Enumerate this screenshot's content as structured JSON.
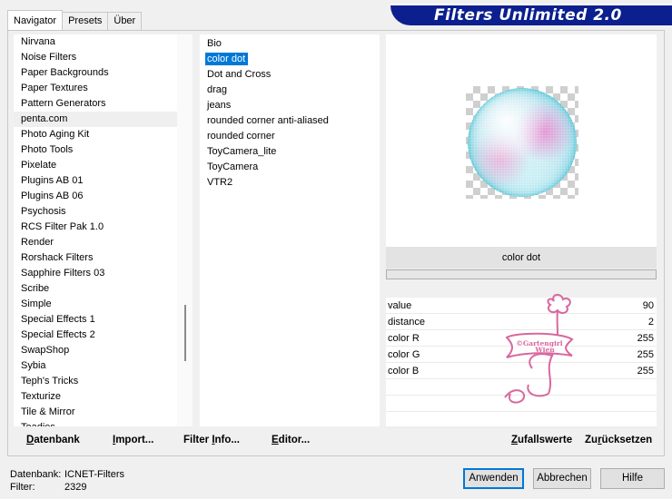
{
  "tabs": [
    {
      "label": "Navigator",
      "active": true
    },
    {
      "label": "Presets",
      "active": false
    },
    {
      "label": "Über",
      "active": false
    }
  ],
  "banner": {
    "title": "Filters Unlimited 2.0",
    "color": "#0b1f8e"
  },
  "categories": [
    {
      "label": "Nirvana"
    },
    {
      "label": "Noise Filters"
    },
    {
      "label": "Paper Backgrounds"
    },
    {
      "label": "Paper Textures"
    },
    {
      "label": "Pattern Generators"
    },
    {
      "label": "penta.com",
      "highlighted": true
    },
    {
      "label": "Photo Aging Kit"
    },
    {
      "label": "Photo Tools"
    },
    {
      "label": "Pixelate"
    },
    {
      "label": "Plugins AB 01"
    },
    {
      "label": "Plugins AB 06"
    },
    {
      "label": "Psychosis"
    },
    {
      "label": "RCS Filter Pak 1.0"
    },
    {
      "label": "Render"
    },
    {
      "label": "Rorshack Filters"
    },
    {
      "label": "Sapphire Filters 03"
    },
    {
      "label": "Scribe"
    },
    {
      "label": "Simple"
    },
    {
      "label": "Special Effects 1"
    },
    {
      "label": "Special Effects 2"
    },
    {
      "label": "SwapShop"
    },
    {
      "label": "Sybia"
    },
    {
      "label": "Teph's Tricks"
    },
    {
      "label": "Texturize"
    },
    {
      "label": "Tile & Mirror"
    },
    {
      "label": "Toadies"
    }
  ],
  "filters": [
    {
      "label": "Bio"
    },
    {
      "label": "color dot",
      "selected": true
    },
    {
      "label": "Dot and Cross"
    },
    {
      "label": "drag"
    },
    {
      "label": "jeans"
    },
    {
      "label": "rounded corner anti-aliased"
    },
    {
      "label": "rounded corner"
    },
    {
      "label": "ToyCamera_lite"
    },
    {
      "label": "ToyCamera"
    },
    {
      "label": "VTR2"
    }
  ],
  "preview": {
    "filter_name": "color dot"
  },
  "params": [
    {
      "label": "value",
      "value": "90"
    },
    {
      "label": "distance",
      "value": "2"
    },
    {
      "label": "color R",
      "value": "255"
    },
    {
      "label": "color G",
      "value": "255"
    },
    {
      "label": "color B",
      "value": "255"
    }
  ],
  "watermark": {
    "line1": "©Gartengirl",
    "line2": "Wien",
    "color": "#d9679e"
  },
  "toolbar_left": {
    "datenbank": {
      "pre": "",
      "u": "D",
      "post": "atenbank"
    },
    "import": {
      "pre": "",
      "u": "I",
      "post": "mport..."
    },
    "filterinfo": {
      "pre": "Filter ",
      "u": "I",
      "post": "nfo..."
    },
    "editor": {
      "pre": "",
      "u": "E",
      "post": "ditor..."
    }
  },
  "toolbar_right": {
    "zufallswerte": {
      "pre": "",
      "u": "Z",
      "post": "ufallswerte"
    },
    "zuruecksetzen": {
      "pre": "Zu",
      "u": "r",
      "post": "ücksetzen"
    }
  },
  "status": {
    "db_label": "Datenbank:",
    "db_value": "ICNET-Filters",
    "filter_label": "Filter:",
    "filter_value": "2329"
  },
  "buttons": {
    "apply": "Anwenden",
    "cancel": "Abbrechen",
    "help": "Hilfe"
  },
  "colors": {
    "selection": "#0078d7",
    "orb_rim": "#28b7c9"
  }
}
